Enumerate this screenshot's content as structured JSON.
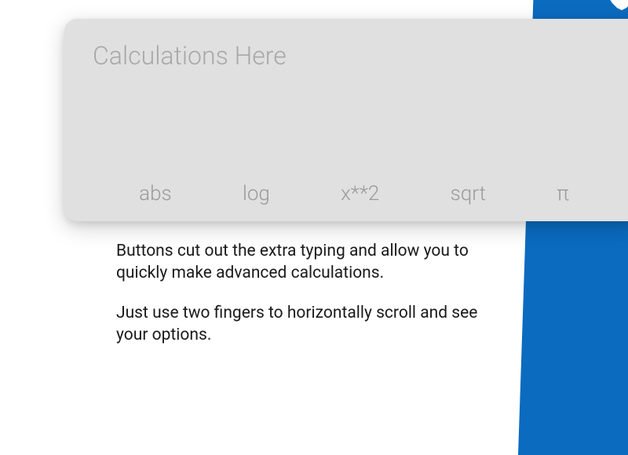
{
  "calculator": {
    "placeholder": "Calculations Here",
    "functions": [
      "abs",
      "log",
      "x**2",
      "sqrt",
      "π"
    ]
  },
  "instructions": {
    "paragraph1": "Buttons cut out the extra typing and allow you to quickly make advanced calculations.",
    "paragraph2": "Just use two fingers to horizontally scroll and see your options."
  }
}
